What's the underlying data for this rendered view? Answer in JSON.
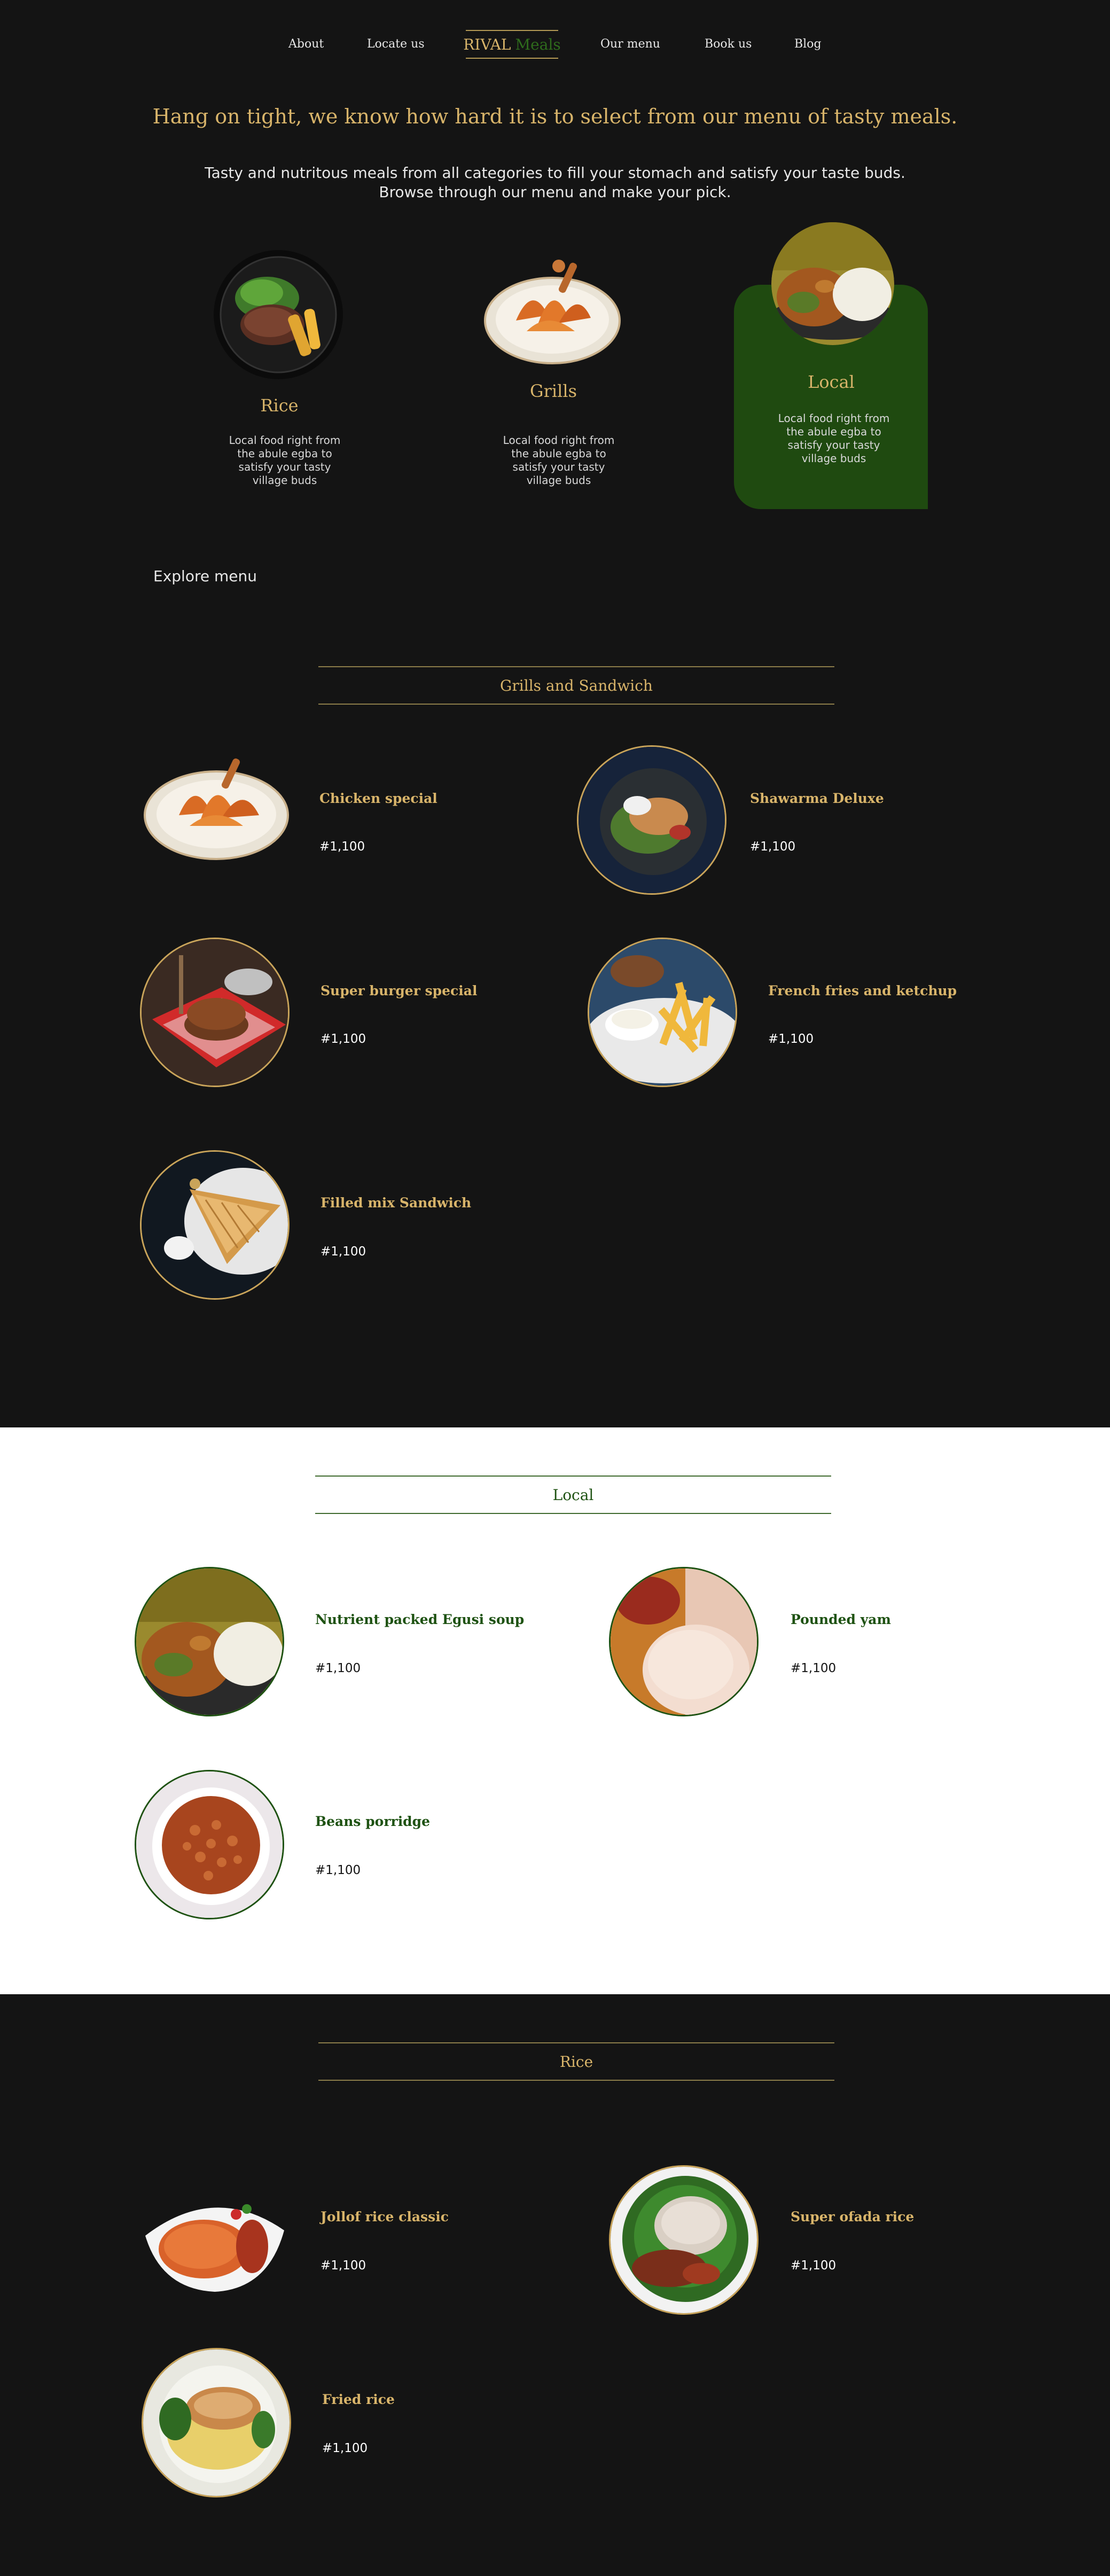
{
  "nav": {
    "about": "About",
    "locate": "Locate us",
    "brand_main": "RIVAL",
    "brand_sub": "Meals",
    "menu": "Our menu",
    "book": "Book us",
    "blog": "Blog"
  },
  "hero": {
    "headline": "Hang on tight, we know how hard it is to select from our menu of tasty meals.",
    "sub_line1": "Tasty and nutritous meals from all categories to fill your stomach and satisfy your taste buds.",
    "sub_line2": "Browse through our menu and make your pick."
  },
  "categories": [
    {
      "title": "Rice",
      "desc": "Local food right from the abule egba to satisfy your tasty village buds"
    },
    {
      "title": "Grills",
      "desc": "Local food right from the abule egba to satisfy your tasty village buds"
    },
    {
      "title": "Local",
      "desc": "Local food right from the abule egba to satisfy your tasty village buds"
    }
  ],
  "explore_label": "Explore menu",
  "sections": {
    "grills": {
      "title": "Grills and Sandwich",
      "items": [
        {
          "name": "Chicken special",
          "price": "#1,100"
        },
        {
          "name": "Shawarma Deluxe",
          "price": "#1,100"
        },
        {
          "name": "Super burger special",
          "price": "#1,100"
        },
        {
          "name": "French fries and ketchup",
          "price": "#1,100"
        },
        {
          "name": "Filled mix Sandwich",
          "price": "#1,100"
        }
      ]
    },
    "local": {
      "title": "Local",
      "items": [
        {
          "name": "Nutrient packed Egusi soup",
          "price": "#1,100"
        },
        {
          "name": "Pounded yam",
          "price": "#1,100"
        },
        {
          "name": "Beans porridge",
          "price": "#1,100"
        }
      ]
    },
    "rice": {
      "title": "Rice",
      "items": [
        {
          "name": "Jollof rice classic",
          "price": "#1,100"
        },
        {
          "name": "Super ofada rice",
          "price": "#1,100"
        },
        {
          "name": "Fried rice",
          "price": "#1,100"
        }
      ]
    }
  },
  "colors": {
    "background": "#141414",
    "gold": "#d8b46a",
    "green": "#1f4a10",
    "white": "#ffffff"
  }
}
